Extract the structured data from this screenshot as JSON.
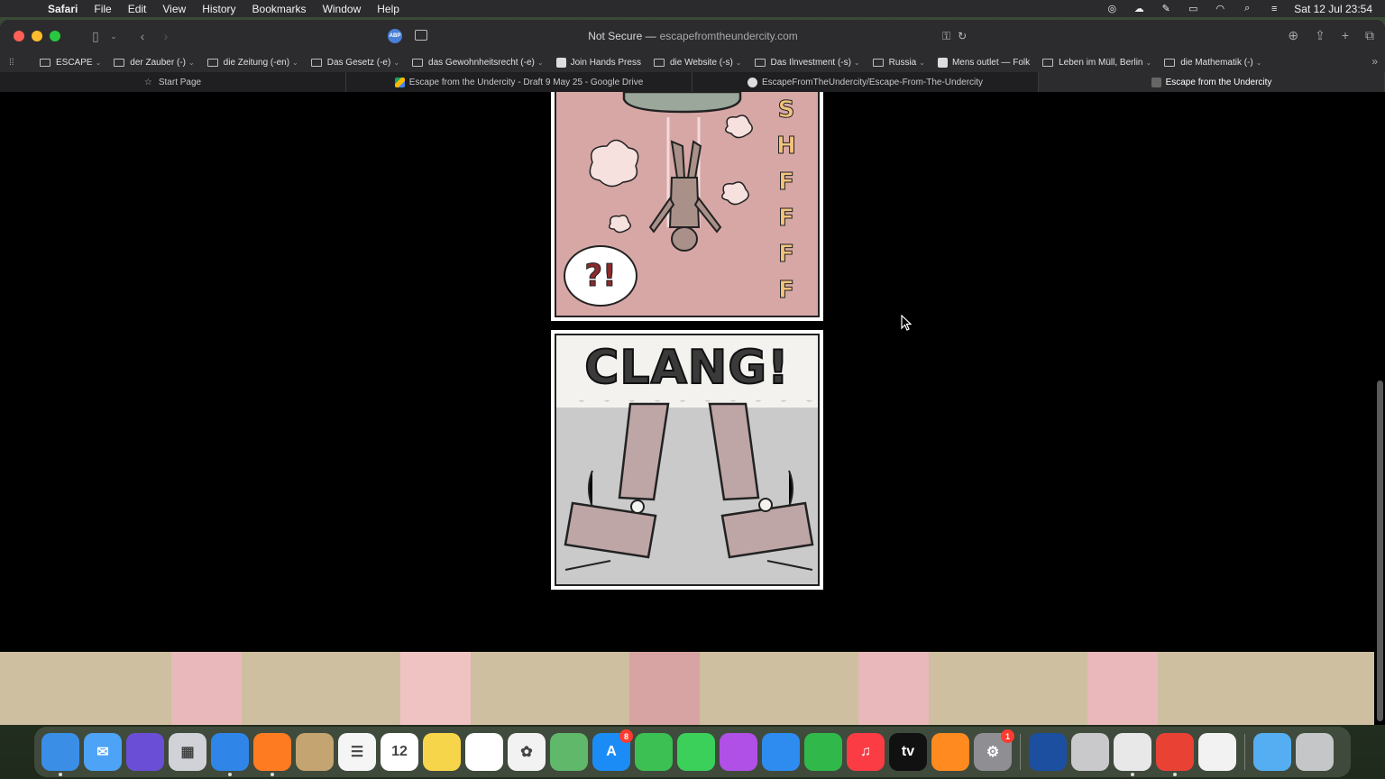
{
  "menubar": {
    "app": "Safari",
    "items": [
      "File",
      "Edit",
      "View",
      "History",
      "Bookmarks",
      "Window",
      "Help"
    ],
    "clock": "Sat 12 Jul  23:54"
  },
  "browser": {
    "url_prefix": "Not Secure —",
    "url_domain": "escapefromtheundercity.com",
    "abp_label": "ABP"
  },
  "bookmarks": [
    {
      "label": "ESCAPE",
      "type": "folder"
    },
    {
      "label": "der Zauber (-)",
      "type": "folder"
    },
    {
      "label": "die Zeitung (-en)",
      "type": "folder"
    },
    {
      "label": "Das Gesetz (-e)",
      "type": "folder"
    },
    {
      "label": "das Gewohnheitsrecht (-e)",
      "type": "folder"
    },
    {
      "label": "Join Hands Press",
      "type": "link"
    },
    {
      "label": "die Website (-s)",
      "type": "folder"
    },
    {
      "label": "Das Ilnvestment (-s)",
      "type": "folder"
    },
    {
      "label": "Russia",
      "type": "folder"
    },
    {
      "label": "Mens outlet — Folk",
      "type": "link"
    },
    {
      "label": "Leben im Müll, Berlin",
      "type": "folder"
    },
    {
      "label": "die Mathematik (-)",
      "type": "folder"
    }
  ],
  "tabs": [
    {
      "label": "Start Page",
      "active": false
    },
    {
      "label": "Escape from the Undercity - Draft 9 May 25 - Google Drive",
      "active": false
    },
    {
      "label": "EscapeFromTheUndercity/Escape-From-The-Undercity",
      "active": false
    },
    {
      "label": "Escape from the Undercity",
      "active": true
    }
  ],
  "comic": {
    "sfx_letters": [
      "S",
      "H",
      "F",
      "F",
      "F",
      "F"
    ],
    "bubble": "?!",
    "clang": "CLANG!"
  },
  "strip_colors": [
    "#cdbf9f",
    "#e9b8ba",
    "#cdbf9f",
    "#f0c3c3",
    "#cdbf9f",
    "#d8a3a3",
    "#cdbf9f",
    "#e9b8ba",
    "#cdbf9f",
    "#eab7ba",
    "#cdbf9f"
  ],
  "dock": [
    {
      "name": "finder",
      "label": "",
      "color": "#3a8ee6",
      "dot": true
    },
    {
      "name": "mail",
      "label": "✉",
      "color": "#4da3f5",
      "dot": false
    },
    {
      "name": "siri",
      "label": "",
      "color": "#6a4fd6",
      "dot": false
    },
    {
      "name": "launchpad",
      "label": "▦",
      "color": "#d0d2d8",
      "dot": false
    },
    {
      "name": "safari",
      "label": "",
      "color": "#2f86e8",
      "dot": true
    },
    {
      "name": "firefox",
      "label": "",
      "color": "#ff7b21",
      "dot": true
    },
    {
      "name": "contacts",
      "label": "",
      "color": "#c4a470",
      "dot": false
    },
    {
      "name": "reminders",
      "label": "☰",
      "color": "#f5f5f5",
      "dot": false
    },
    {
      "name": "calendar",
      "label": "12",
      "color": "#ffffff",
      "dot": false
    },
    {
      "name": "notes",
      "label": "",
      "color": "#f7d54a",
      "dot": false
    },
    {
      "name": "freeform",
      "label": "",
      "color": "#ffffff",
      "dot": false
    },
    {
      "name": "photos",
      "label": "✿",
      "color": "#f2f2f2",
      "dot": false
    },
    {
      "name": "maps",
      "label": "",
      "color": "#60b86a",
      "dot": false
    },
    {
      "name": "app-store",
      "label": "A",
      "color": "#1b8cf5",
      "dot": false,
      "badge": "8"
    },
    {
      "name": "facetime",
      "label": "",
      "color": "#3cc054",
      "dot": false
    },
    {
      "name": "messages",
      "label": "",
      "color": "#3ad05a",
      "dot": false
    },
    {
      "name": "podcasts",
      "label": "",
      "color": "#b050e6",
      "dot": false
    },
    {
      "name": "keynote",
      "label": "",
      "color": "#2e8cf0",
      "dot": false
    },
    {
      "name": "numbers",
      "label": "",
      "color": "#30b94a",
      "dot": false
    },
    {
      "name": "music",
      "label": "♫",
      "color": "#fc3c44",
      "dot": false
    },
    {
      "name": "apple-tv",
      "label": "tv",
      "color": "#111111",
      "dot": false
    },
    {
      "name": "books",
      "label": "",
      "color": "#ff8a1f",
      "dot": false
    },
    {
      "name": "system-settings",
      "label": "⚙",
      "color": "#8e8e93",
      "dot": false,
      "badge": "1"
    },
    {
      "name": "split-app",
      "label": "",
      "color": "#1d4fa0",
      "dot": false
    },
    {
      "name": "notes-app",
      "label": "",
      "color": "#c9c9cc",
      "dot": false
    },
    {
      "name": "chatgpt",
      "label": "",
      "color": "#e8e8e8",
      "dot": true
    },
    {
      "name": "chrome",
      "label": "",
      "color": "#e94235",
      "dot": true
    },
    {
      "name": "textedit",
      "label": "",
      "color": "#f2f2f2",
      "dot": false
    },
    {
      "name": "downloads-folder",
      "label": "",
      "color": "#56aef2",
      "dot": false
    },
    {
      "name": "trash",
      "label": "",
      "color": "#c4c6c8",
      "dot": false
    }
  ]
}
